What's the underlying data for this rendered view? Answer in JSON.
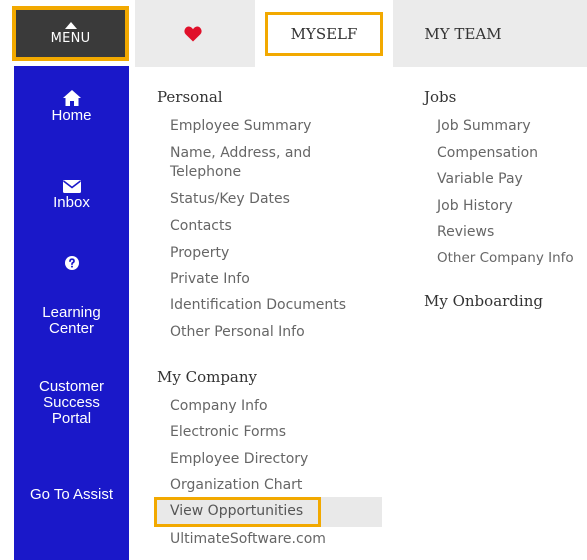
{
  "sidebar": {
    "menu_label": "MENU",
    "items": [
      {
        "label": "Home",
        "icon": "home-icon"
      },
      {
        "label": "Inbox",
        "icon": "envelope-icon"
      },
      {
        "label": "",
        "icon": "question-circle-icon"
      },
      {
        "label": "Learning Center",
        "line1": "Learning",
        "line2": "Center"
      },
      {
        "label": "Customer Success Portal",
        "line1": "Customer",
        "line2": "Success",
        "line3": "Portal"
      },
      {
        "label": "Go To Assist"
      }
    ]
  },
  "tabs": {
    "heart_icon": "heart-icon",
    "myself": "MYSELF",
    "myteam": "MY TEAM"
  },
  "personal": {
    "title": "Personal",
    "links": [
      "Employee Summary",
      "Name, Address, and",
      "Telephone",
      "Status/Key Dates",
      "Contacts",
      "Property",
      "Private Info",
      "Identification Documents",
      "Other Personal Info"
    ]
  },
  "company": {
    "title": "My Company",
    "links": [
      "Company Info",
      "Electronic Forms",
      "Employee Directory",
      "Organization Chart",
      "View Opportunities",
      "UltimateSoftware.com"
    ]
  },
  "jobs": {
    "title": "Jobs",
    "links": [
      "Job Summary",
      "Compensation",
      "Variable Pay",
      "Job History",
      "Reviews",
      "Other Company Info"
    ]
  },
  "onboarding": {
    "title": "My Onboarding"
  },
  "colors": {
    "nav_blue": "#1a18c9",
    "highlight_orange": "#f2a900",
    "heart_red": "#e0102a",
    "menu_dark": "#3a3a3a"
  }
}
